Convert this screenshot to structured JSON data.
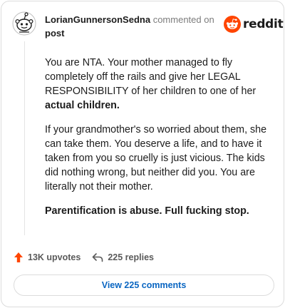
{
  "header": {
    "username": "LorianGunnersonSedna",
    "commented_text": "commented on",
    "post_label": "post",
    "avatar_icon": "snoo-avatar-icon"
  },
  "brand": {
    "wordmark": "reddit",
    "accent": "#ff4500"
  },
  "comment": {
    "paragraph1_plain": "You are NTA. Your mother managed to fly completely off the rails and give her LEGAL RESPONSIBILITY of her children to one of her ",
    "paragraph1_bold": "actual children.",
    "paragraph2": "If your grandmother's so worried about them, she can take them. You deserve a life, and to have it taken from you so cruelly is just vicious. The kids did nothing wrong, but neither did you. You are literally not their mother.",
    "paragraph3_bold": "Parentification is abuse. Full fucking stop."
  },
  "actions": {
    "upvotes": "13K upvotes",
    "replies": "225 replies",
    "upvote_icon": "upvote-arrow-icon",
    "reply_icon": "reply-arrow-icon"
  },
  "view_comments_button": "View 225 comments"
}
